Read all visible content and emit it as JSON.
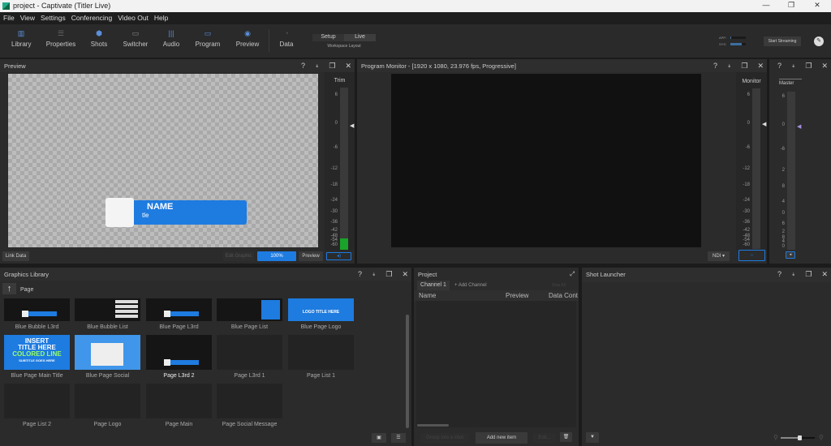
{
  "window": {
    "title": "project - Captivate (Titler Live)",
    "minimize": "—",
    "maximize": "❐",
    "close": "✕"
  },
  "menu": [
    "File",
    "View",
    "Settings",
    "Conferencing",
    "Video Out",
    "Help"
  ],
  "toolbar": {
    "items": [
      {
        "label": "Library",
        "icon": "library-icon"
      },
      {
        "label": "Properties",
        "icon": "list-icon"
      },
      {
        "label": "Shots",
        "icon": "cube-icon"
      },
      {
        "label": "Switcher",
        "icon": "switcher-icon"
      },
      {
        "label": "Audio",
        "icon": "audio-bars-icon"
      },
      {
        "label": "Program",
        "icon": "monitor-icon"
      },
      {
        "label": "Preview",
        "icon": "eye-icon"
      },
      {
        "label": "Data",
        "icon": "clock-icon"
      }
    ],
    "workspace": {
      "setup": "Setup",
      "live": "Live",
      "caption": "Workspace Layout",
      "selected": "Live"
    },
    "usage": {
      "app_label": "APP:",
      "sys_label": "SYS:",
      "app": 0.05,
      "sys": 0.75
    },
    "start_streaming": "Start Streaming",
    "avatar": "✎"
  },
  "preview_panel": {
    "title": "Preview",
    "trim_label": "Trim",
    "meter_ticks": [
      "6",
      "0",
      "-6",
      "-12",
      "-18",
      "-24",
      "-30",
      "-36",
      "-42",
      "-48",
      "-54",
      "-60"
    ],
    "lower_third": {
      "name": "NAME",
      "subtitle": "tle"
    },
    "link_data": "Link Data",
    "edit_graphic": "Edit Graphic",
    "zoom": "100%",
    "preview_btn": "Preview"
  },
  "program_panel": {
    "title": "Program Monitor - [1920 x 1080, 23.976 fps, Progressive]",
    "monitor_label": "Monitor",
    "output_select": "NDI"
  },
  "master_panel": {
    "label": "Master",
    "meter_ticks": [
      "6",
      "0",
      "-6",
      "2",
      "8",
      "4",
      "0",
      "6",
      "2",
      "8",
      "4",
      "0"
    ]
  },
  "library": {
    "title": "Graphics Library",
    "path": "Page",
    "items": [
      "Blue Bubble L3rd",
      "Blue Bubble List",
      "Blue Page L3rd",
      "Blue Page List",
      "Blue Page Logo",
      "Blue Page Main Title",
      "Blue Page Social",
      "Page  L3rd 2",
      "Page L3rd 1",
      "Page List 1",
      "Page List 2",
      "Page Logo",
      "Page Main",
      "Page Social Message"
    ],
    "logo_thumb_text": "LOGO TITLE HERE",
    "main_title_thumb": [
      "INSERT",
      "TITLE HERE",
      "COLORED LINE",
      "SUBTITLE GOES HERE"
    ]
  },
  "project": {
    "title": "Project",
    "tabs": [
      "Channel 1",
      "+ Add Channel"
    ],
    "stop_all": "Stop All",
    "columns": [
      "Name",
      "Preview",
      "Data Cont"
    ],
    "group_btn": "Group into a shot",
    "add_btn": "Add new item",
    "edit_btn": "Edit..."
  },
  "shot_launcher": {
    "title": "Shot Launcher",
    "zoom": 0.55
  },
  "colors": {
    "accent": "#1e7be0",
    "meter_green": "#1aa32a"
  }
}
